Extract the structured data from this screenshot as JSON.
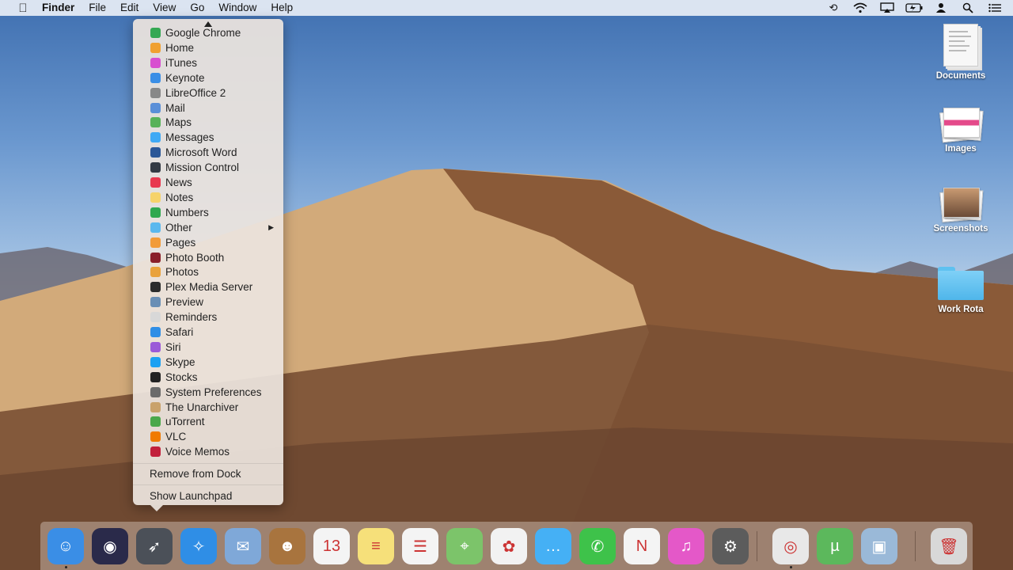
{
  "menubar": {
    "app_name": "Finder",
    "menus": [
      "File",
      "Edit",
      "View",
      "Go",
      "Window",
      "Help"
    ],
    "status_icons": [
      "time-machine-icon",
      "wifi-icon",
      "airplay-icon",
      "battery-icon",
      "user-icon",
      "spotlight-icon",
      "notification-center-icon"
    ]
  },
  "desktop_icons": [
    {
      "label": "Documents",
      "icon": "document-icon"
    },
    {
      "label": "Images",
      "icon": "image-stack-icon"
    },
    {
      "label": "Screenshots",
      "icon": "screenshot-stack-icon"
    },
    {
      "label": "Work Rota",
      "icon": "folder-icon"
    }
  ],
  "dock_menu": {
    "items": [
      {
        "label": "Google Chrome",
        "color": "#34a853"
      },
      {
        "label": "Home",
        "color": "#f0a030"
      },
      {
        "label": "iTunes",
        "color": "#d84fd0"
      },
      {
        "label": "Keynote",
        "color": "#3a8ee6"
      },
      {
        "label": "LibreOffice 2",
        "color": "#888888"
      },
      {
        "label": "Mail",
        "color": "#5a8fd8"
      },
      {
        "label": "Maps",
        "color": "#58b25a"
      },
      {
        "label": "Messages",
        "color": "#3fa9f5"
      },
      {
        "label": "Microsoft Word",
        "color": "#2b5797"
      },
      {
        "label": "Mission Control",
        "color": "#333a44"
      },
      {
        "label": "News",
        "color": "#e8384f"
      },
      {
        "label": "Notes",
        "color": "#f6d36a"
      },
      {
        "label": "Numbers",
        "color": "#2fa84f"
      },
      {
        "label": "Other",
        "color": "#5ab8ee",
        "submenu": true
      },
      {
        "label": "Pages",
        "color": "#f29b38"
      },
      {
        "label": "Photo Booth",
        "color": "#8a1f2a"
      },
      {
        "label": "Photos",
        "color": "#e9a23b"
      },
      {
        "label": "Plex Media Server",
        "color": "#2b2b2b"
      },
      {
        "label": "Preview",
        "color": "#6a8fb5"
      },
      {
        "label": "Reminders",
        "color": "#d8d8d8"
      },
      {
        "label": "Safari",
        "color": "#2f8ee6"
      },
      {
        "label": "Siri",
        "color": "#9b5ad8"
      },
      {
        "label": "Skype",
        "color": "#1da1f2"
      },
      {
        "label": "Stocks",
        "color": "#222222"
      },
      {
        "label": "System Preferences",
        "color": "#6b6b6b"
      },
      {
        "label": "The Unarchiver",
        "color": "#c9a26b"
      },
      {
        "label": "uTorrent",
        "color": "#4aa84a"
      },
      {
        "label": "VLC",
        "color": "#f07a00"
      },
      {
        "label": "Voice Memos",
        "color": "#c2203c"
      }
    ],
    "actions": [
      "Remove from Dock",
      "Show Launchpad"
    ]
  },
  "dock": {
    "apps": [
      {
        "name": "finder-icon",
        "color": "#3a8ee6",
        "glyph": "☺",
        "running": true
      },
      {
        "name": "siri-icon",
        "color": "#2a2a4a",
        "glyph": "◉",
        "running": false
      },
      {
        "name": "launchpad-icon",
        "color": "#4b5058",
        "glyph": "➶",
        "running": false
      },
      {
        "name": "safari-icon",
        "color": "#2f8ee6",
        "glyph": "✧",
        "running": false
      },
      {
        "name": "mail-icon",
        "color": "#7fa8d8",
        "glyph": "✉",
        "running": false
      },
      {
        "name": "contacts-icon",
        "color": "#a8743e",
        "glyph": "☻",
        "running": false
      },
      {
        "name": "calendar-icon",
        "color": "#f4f4f4",
        "glyph": "13",
        "running": false
      },
      {
        "name": "notes-icon",
        "color": "#f6e07a",
        "glyph": "≡",
        "running": false
      },
      {
        "name": "reminders-icon",
        "color": "#f4f4f4",
        "glyph": "☰",
        "running": false
      },
      {
        "name": "maps-icon",
        "color": "#7cc46a",
        "glyph": "⌖",
        "running": false
      },
      {
        "name": "photos-icon",
        "color": "#f2f2f2",
        "glyph": "✿",
        "running": false
      },
      {
        "name": "messages-icon",
        "color": "#45b0f5",
        "glyph": "…",
        "running": false
      },
      {
        "name": "facetime-icon",
        "color": "#3ec24a",
        "glyph": "✆",
        "running": false
      },
      {
        "name": "news-icon",
        "color": "#f4f4f4",
        "glyph": "N",
        "running": false
      },
      {
        "name": "itunes-icon",
        "color": "#e458c8",
        "glyph": "♫",
        "running": false
      },
      {
        "name": "system-preferences-icon",
        "color": "#5c5c5c",
        "glyph": "⚙",
        "running": false
      },
      {
        "name": "chrome-icon",
        "color": "#e8e8e8",
        "glyph": "◎",
        "running": true
      },
      {
        "name": "utorrent-icon",
        "color": "#5cb85c",
        "glyph": "µ",
        "running": false
      },
      {
        "name": "preview-icon",
        "color": "#9ab9d8",
        "glyph": "▣",
        "running": false
      },
      {
        "name": "trash-icon",
        "color": "#d8d8d8",
        "glyph": "🗑",
        "running": false
      }
    ]
  }
}
